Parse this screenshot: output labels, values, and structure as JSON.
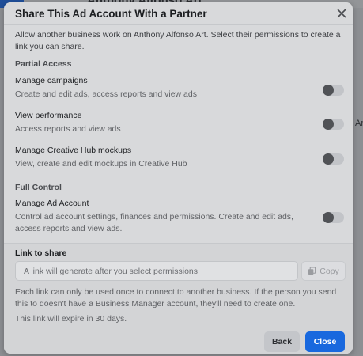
{
  "background": {
    "page_title": "Anthony Alfonso Art",
    "side_text": "Ar"
  },
  "modal": {
    "title": "Share This Ad Account With a Partner",
    "close_icon": "close-icon",
    "intro": "Allow another business work on Anthony Alfonso Art. Select their permissions to create a link you can share.",
    "partial_access": {
      "label": "Partial Access",
      "permissions": [
        {
          "title": "Manage campaigns",
          "description": "Create and edit ads, access reports and view ads",
          "enabled": false
        },
        {
          "title": "View performance",
          "description": "Access reports and view ads",
          "enabled": false
        },
        {
          "title": "Manage Creative Hub mockups",
          "description": "View, create and edit mockups in Creative Hub",
          "enabled": false
        }
      ]
    },
    "full_control": {
      "label": "Full Control",
      "permissions": [
        {
          "title": "Manage Ad Account",
          "description": "Control ad account settings, finances and permissions. Create and edit ads, access reports and view ads.",
          "enabled": false
        }
      ]
    },
    "link": {
      "title": "Link to share",
      "placeholder": "A link will generate after you select permissions",
      "copy_label": "Copy",
      "copy_icon": "copy-icon",
      "note": "Each link can only be used once to connect to another business. If the person you send this to doesn't have a Business Manager account, they'll need to create one.",
      "expire": "This link will expire in 30 days."
    },
    "buttons": {
      "back": "Back",
      "close": "Close"
    }
  },
  "colors": {
    "primary": "#1868de",
    "overlay": "#8d8f93",
    "toggle_track": "#c2c4c8",
    "toggle_knob": "#505256"
  }
}
